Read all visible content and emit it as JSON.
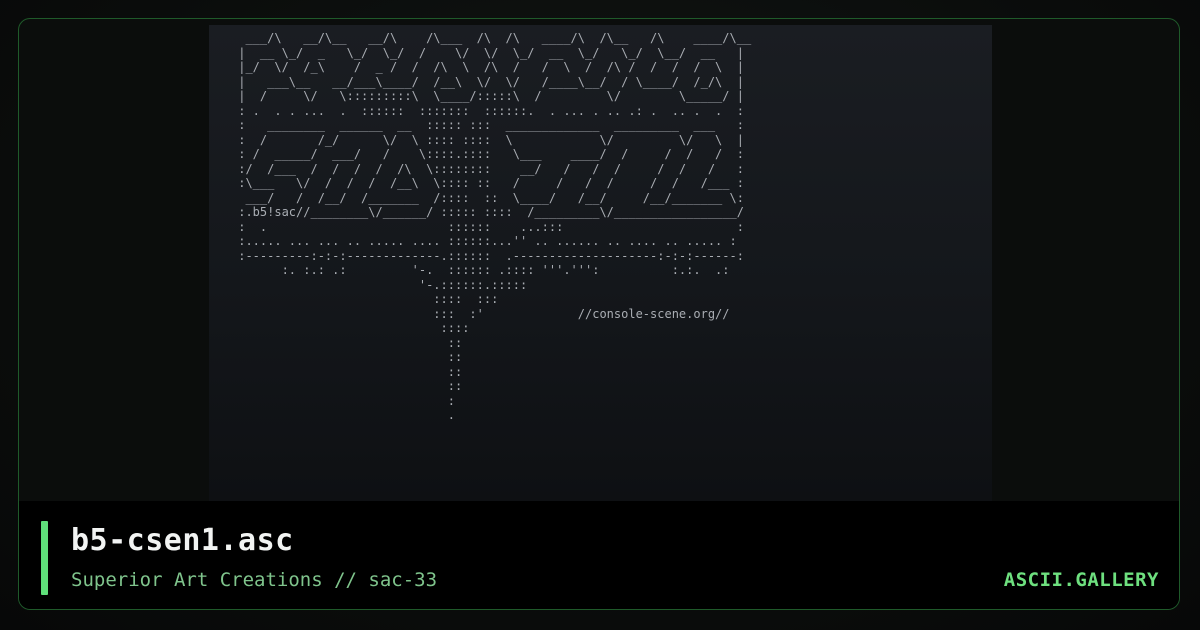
{
  "art": {
    "lines": [
      "  ___/\\   __/\\__   __/\\    /\\___  /\\  /\\   ____/\\  /\\__   /\\    ____/\\__",
      " |  __ \\_/  _   \\_/  \\_/  /    \\/  \\/  \\_/  __  \\_/   \\_/  \\__/  __   |",
      " |_/  \\/  /_\\    /  _ /  /  /\\  \\  /\\  /   /  \\  /  /\\ /  /  /  /  \\  |",
      " |   ___\\__   __/___\\____/  /__\\  \\/  \\/   /____\\__/  / \\____/  /_/\\  |",
      " |  /     \\/   \\:::::::::\\  \\____/:::::\\  /         \\/        \\_____/ |",
      " : .  . . ...  .  ::::::  :::::::  ::::::.  . ... . .. .: .  .. .  .  :",
      " :   ________  ______  __  ::::: :::  _____________  _________  ___   :",
      " :  /       /_/      \\/  \\ :::: ::::  \\            \\/         \\/   \\  |",
      " : /  _____/  ___/   /    \\::::.::::   \\___    ____/  /     /  /   /  :",
      " :/  /___  /  /  /  /  /\\  \\::::::::    __/   /   /  /     /  /   /   :",
      " :\\___   \\/  /  /  /  /__\\  \\:::: ::   /     /   /  /     /  /   /___ :",
      "  ___/   /  /__/  /_______  /::::  ::  \\____/   /__/     /__/_______ \\:",
      " :.b5!sac//________\\/______/ ::::: ::::  /_________\\/_________________/",
      " :  .                         ::::::    ...:::                        :",
      " :..... ... ... .. ..... .... ::::::...'' .. ...... .. .... .. ..... :",
      " :---------:-:-:-------------.::::::  .--------------------:-:-:------:",
      "       :. :.: .:         '-.  :::::: .:::: '''.''':          :.:.  .:",
      "                          '-.::::::.:::::",
      "                            ::::  :::",
      "                            :::  :'             //console-scene.org//",
      "                             ::::",
      "                              ::",
      "                              ::",
      "                              ::",
      "                              ::",
      "                              :",
      "                              ."
    ]
  },
  "info": {
    "title": "b5-csen1.asc",
    "subtitle": "Superior Art Creations // sac-33",
    "brand": "ASCII.GALLERY"
  },
  "colors": {
    "accent": "#5fe07a",
    "border": "#1f5a2a",
    "title": "#f2f4f3",
    "subtitle": "#7fc48c",
    "brand": "#6ee07f"
  }
}
